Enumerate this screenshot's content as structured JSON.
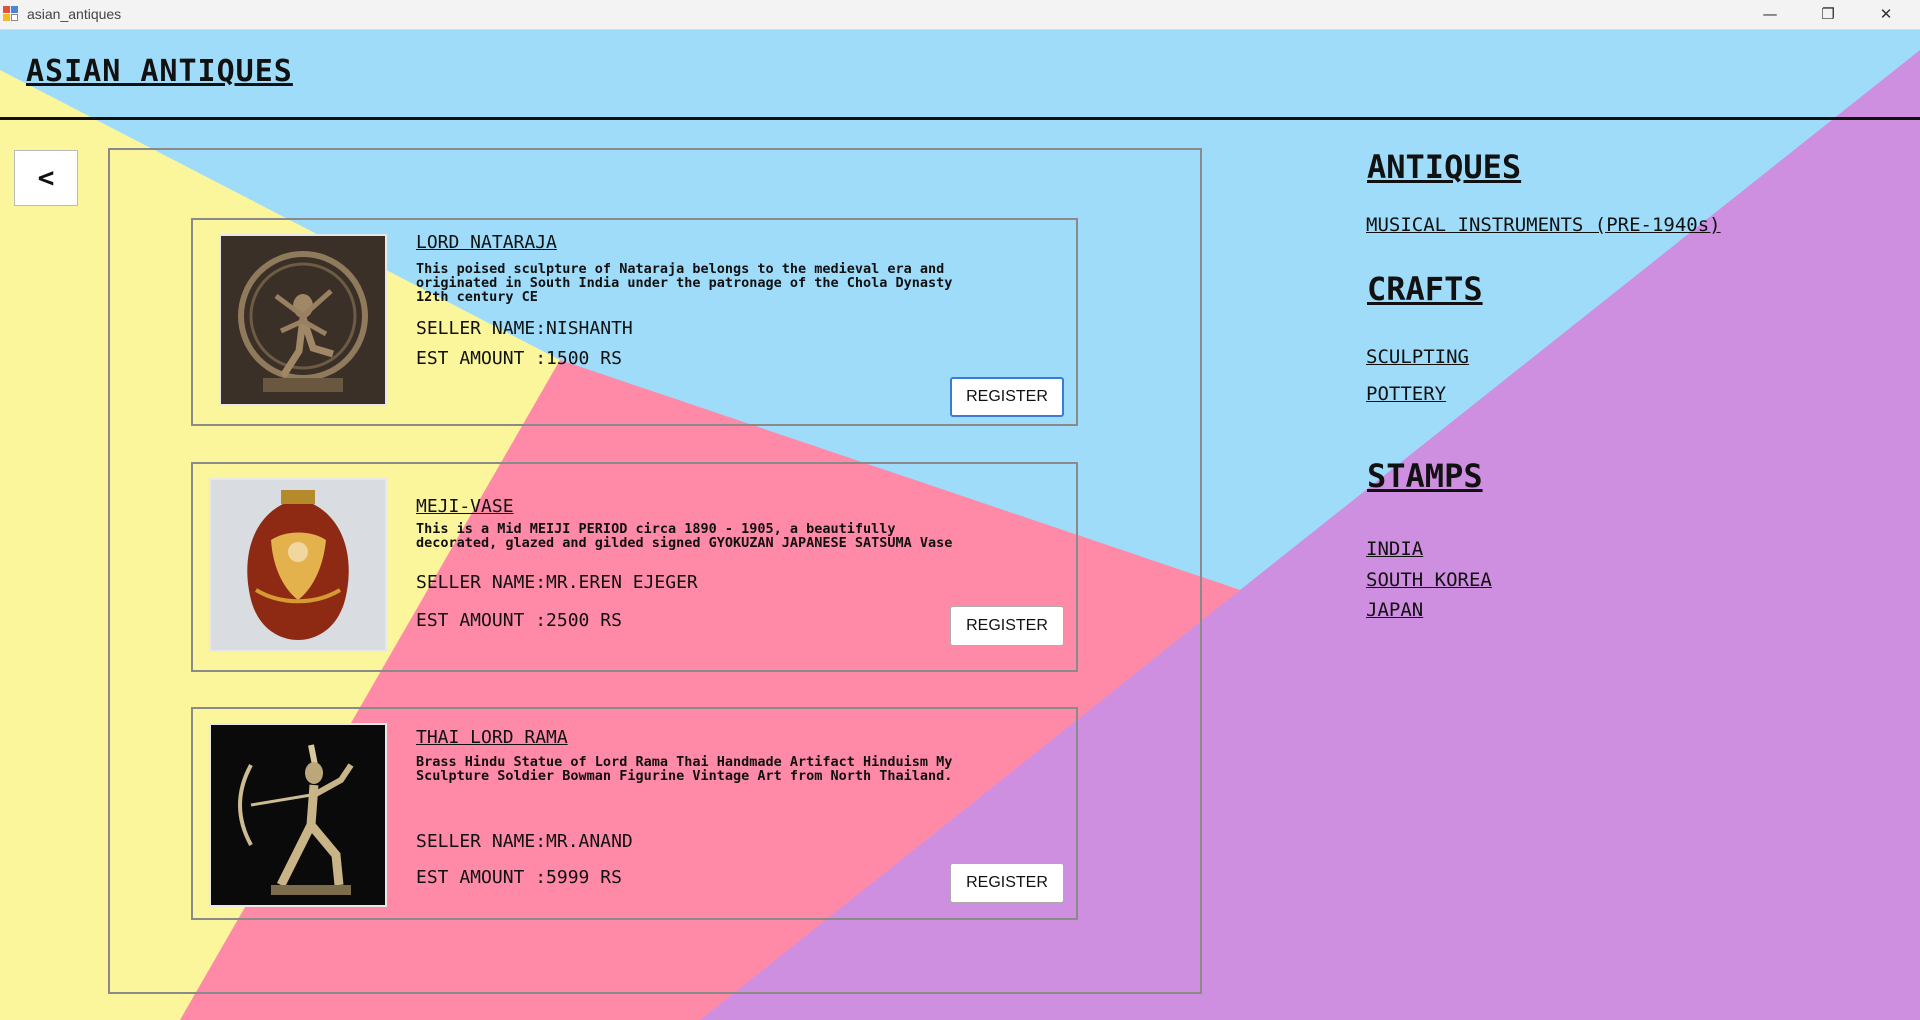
{
  "window": {
    "title": "asian_antiques",
    "minimize": "—",
    "maximize": "❐",
    "close": "✕"
  },
  "app": {
    "title": "ASIAN ANTIQUES",
    "back_label": "<"
  },
  "listings": [
    {
      "name": "LORD NATARAJA",
      "description": "This poised sculpture of Nataraja belongs to the medieval era and\noriginated in South India under the patronage of the Chola Dynasty\n12th century CE",
      "seller": "SELLER NAME:NISHANTH",
      "amount": "EST AMOUNT :1500 RS",
      "register_label": "REGISTER"
    },
    {
      "name": "MEJI-VASE",
      "description": "This is a Mid MEIJI PERIOD circa 1890 - 1905, a beautifully\ndecorated, glazed and gilded signed GYOKUZAN JAPANESE SATSUMA Vase",
      "seller": "SELLER NAME:MR.EREN EJEGER",
      "amount": "EST AMOUNT :2500 RS",
      "register_label": "REGISTER"
    },
    {
      "name": "THAI LORD RAMA",
      "description": "Brass Hindu Statue of Lord Rama Thai Handmade Artifact Hinduism My\nSculpture Soldier Bowman Figurine Vintage Art from North Thailand.",
      "seller": "SELLER NAME:MR.ANAND",
      "amount": "EST AMOUNT :5999 RS",
      "register_label": "REGISTER"
    }
  ],
  "sidebar": {
    "antiques": {
      "heading": "ANTIQUES",
      "items": [
        "MUSICAL INSTRUMENTS (PRE-1940s)"
      ]
    },
    "crafts": {
      "heading": "CRAFTS",
      "items": [
        "SCULPTING",
        "POTTERY"
      ]
    },
    "stamps": {
      "heading": "STAMPS",
      "items": [
        "INDIA",
        "SOUTH KOREA",
        "JAPAN"
      ]
    }
  },
  "colors": {
    "sky": "#9edcfa",
    "yellow": "#fbf59c",
    "pink": "#ff8aa8",
    "purple": "#cf8fe0"
  }
}
